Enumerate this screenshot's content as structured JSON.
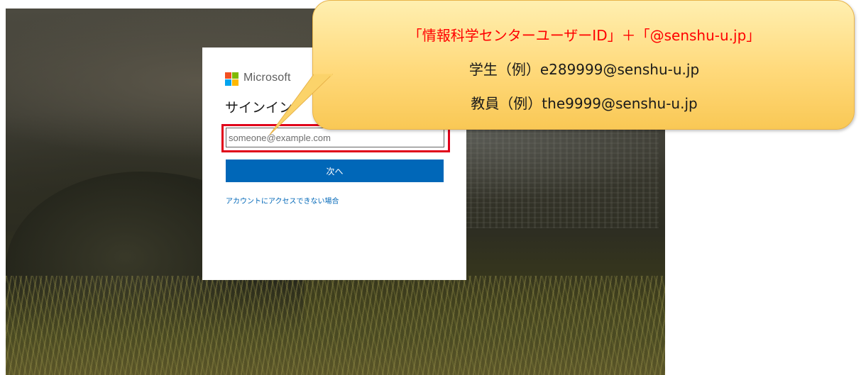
{
  "signin": {
    "brand": "Microsoft",
    "title": "サインイン",
    "email_placeholder": "someone@example.com",
    "next_label": "次へ",
    "help_link": "アカウントにアクセスできない場合"
  },
  "callout": {
    "line1": "「情報科学センターユーザーID」＋「@senshu-u.jp」",
    "line2": "学生（例）e289999@senshu-u.jp",
    "line3": "教員（例）the9999@senshu-u.jp"
  },
  "colors": {
    "accent_blue": "#0067b8",
    "highlight_red": "#e0001a",
    "callout_fill": "#ffd97a",
    "callout_title": "#ff0000"
  },
  "icons": {
    "brand_logo": "microsoft-logo-icon"
  }
}
